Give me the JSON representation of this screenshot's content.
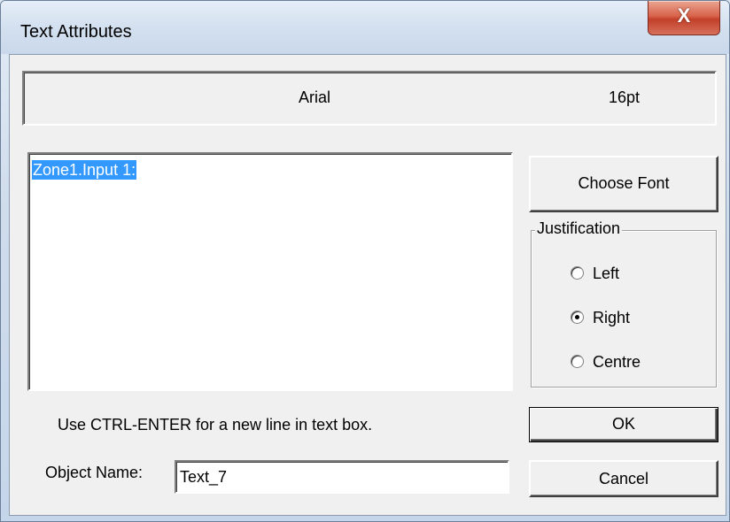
{
  "window": {
    "title": "Text Attributes",
    "close_glyph": "X"
  },
  "font": {
    "name": "Arial",
    "size": "16pt"
  },
  "textbox": {
    "selected_text": "Zone1.Input 1:"
  },
  "buttons": {
    "choose_font": "Choose Font",
    "ok": "OK",
    "cancel": "Cancel"
  },
  "justification": {
    "label": "Justification",
    "options": [
      {
        "label": "Left",
        "checked": false
      },
      {
        "label": "Right",
        "checked": true
      },
      {
        "label": "Centre",
        "checked": false
      }
    ]
  },
  "hint": "Use CTRL-ENTER for a new line in text box.",
  "object_name": {
    "label": "Object Name:",
    "value": "Text_7"
  }
}
